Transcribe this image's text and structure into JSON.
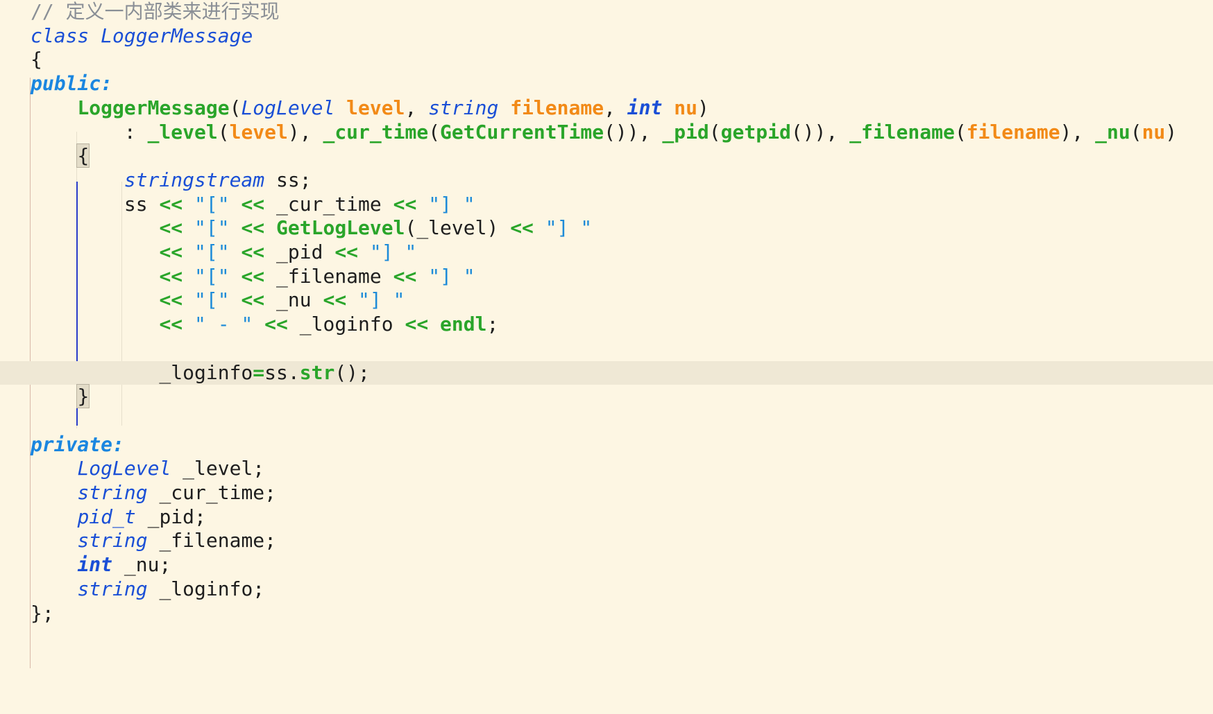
{
  "editor": {
    "theme": {
      "background": "#fdf6e3",
      "current_line": "#efe8d5",
      "comment": "#8a8f96",
      "keyword": "#1a86e0",
      "type": "#1a4fd6",
      "function": "#2aa52a",
      "parameter": "#f28a17",
      "string": "#1d8bd8"
    },
    "current_line_index": 15,
    "lines": [
      {
        "tokens": [
          {
            "c": "t-comment",
            "t": "// 定义一内部类来进行实现"
          }
        ]
      },
      {
        "tokens": [
          {
            "c": "t-storage",
            "t": "class"
          },
          {
            "c": "t-plain",
            "t": " "
          },
          {
            "c": "t-type",
            "t": "LoggerMessage"
          }
        ]
      },
      {
        "tokens": [
          {
            "c": "t-plain",
            "t": "{"
          }
        ]
      },
      {
        "tokens": [
          {
            "c": "t-kw",
            "t": "public:"
          }
        ]
      },
      {
        "tokens": [
          {
            "c": "t-plain",
            "t": "    "
          },
          {
            "c": "t-func",
            "t": "LoggerMessage"
          },
          {
            "c": "t-plain",
            "t": "("
          },
          {
            "c": "t-type",
            "t": "LogLevel"
          },
          {
            "c": "t-plain",
            "t": " "
          },
          {
            "c": "t-param",
            "t": "level"
          },
          {
            "c": "t-plain",
            "t": ", "
          },
          {
            "c": "t-type",
            "t": "string"
          },
          {
            "c": "t-plain",
            "t": " "
          },
          {
            "c": "t-param",
            "t": "filename"
          },
          {
            "c": "t-plain",
            "t": ", "
          },
          {
            "c": "t-typeb",
            "t": "int"
          },
          {
            "c": "t-plain",
            "t": " "
          },
          {
            "c": "t-param",
            "t": "nu"
          },
          {
            "c": "t-plain",
            "t": ")"
          }
        ]
      },
      {
        "tokens": [
          {
            "c": "t-plain",
            "t": "        : "
          },
          {
            "c": "t-member",
            "t": "_level"
          },
          {
            "c": "t-plain",
            "t": "("
          },
          {
            "c": "t-param",
            "t": "level"
          },
          {
            "c": "t-plain",
            "t": "), "
          },
          {
            "c": "t-member",
            "t": "_cur_time"
          },
          {
            "c": "t-plain",
            "t": "("
          },
          {
            "c": "t-func",
            "t": "GetCurrentTime"
          },
          {
            "c": "t-plain",
            "t": "()), "
          },
          {
            "c": "t-member",
            "t": "_pid"
          },
          {
            "c": "t-plain",
            "t": "("
          },
          {
            "c": "t-func",
            "t": "getpid"
          },
          {
            "c": "t-plain",
            "t": "()), "
          },
          {
            "c": "t-member",
            "t": "_filename"
          },
          {
            "c": "t-plain",
            "t": "("
          },
          {
            "c": "t-param",
            "t": "filename"
          },
          {
            "c": "t-plain",
            "t": "), "
          },
          {
            "c": "t-member",
            "t": "_nu"
          },
          {
            "c": "t-plain",
            "t": "("
          },
          {
            "c": "t-param",
            "t": "nu"
          },
          {
            "c": "t-plain",
            "t": ")"
          }
        ]
      },
      {
        "tokens": [
          {
            "c": "t-plain",
            "t": "    "
          },
          {
            "c": "brace-hl",
            "t": "{"
          }
        ]
      },
      {
        "tokens": [
          {
            "c": "t-plain",
            "t": "        "
          },
          {
            "c": "t-type",
            "t": "stringstream"
          },
          {
            "c": "t-plain",
            "t": " ss;"
          }
        ]
      },
      {
        "tokens": [
          {
            "c": "t-plain",
            "t": "        ss "
          },
          {
            "c": "t-op",
            "t": "<<"
          },
          {
            "c": "t-plain",
            "t": " "
          },
          {
            "c": "t-str",
            "t": "\"[\""
          },
          {
            "c": "t-plain",
            "t": " "
          },
          {
            "c": "t-op",
            "t": "<<"
          },
          {
            "c": "t-plain",
            "t": " _cur_time "
          },
          {
            "c": "t-op",
            "t": "<<"
          },
          {
            "c": "t-plain",
            "t": " "
          },
          {
            "c": "t-str",
            "t": "\"] \""
          }
        ]
      },
      {
        "tokens": [
          {
            "c": "t-plain",
            "t": "           "
          },
          {
            "c": "t-op",
            "t": "<<"
          },
          {
            "c": "t-plain",
            "t": " "
          },
          {
            "c": "t-str",
            "t": "\"[\""
          },
          {
            "c": "t-plain",
            "t": " "
          },
          {
            "c": "t-op",
            "t": "<<"
          },
          {
            "c": "t-plain",
            "t": " "
          },
          {
            "c": "t-func",
            "t": "GetLogLevel"
          },
          {
            "c": "t-plain",
            "t": "(_level) "
          },
          {
            "c": "t-op",
            "t": "<<"
          },
          {
            "c": "t-plain",
            "t": " "
          },
          {
            "c": "t-str",
            "t": "\"] \""
          }
        ]
      },
      {
        "tokens": [
          {
            "c": "t-plain",
            "t": "           "
          },
          {
            "c": "t-op",
            "t": "<<"
          },
          {
            "c": "t-plain",
            "t": " "
          },
          {
            "c": "t-str",
            "t": "\"[\""
          },
          {
            "c": "t-plain",
            "t": " "
          },
          {
            "c": "t-op",
            "t": "<<"
          },
          {
            "c": "t-plain",
            "t": " _pid "
          },
          {
            "c": "t-op",
            "t": "<<"
          },
          {
            "c": "t-plain",
            "t": " "
          },
          {
            "c": "t-str",
            "t": "\"] \""
          }
        ]
      },
      {
        "tokens": [
          {
            "c": "t-plain",
            "t": "           "
          },
          {
            "c": "t-op",
            "t": "<<"
          },
          {
            "c": "t-plain",
            "t": " "
          },
          {
            "c": "t-str",
            "t": "\"[\""
          },
          {
            "c": "t-plain",
            "t": " "
          },
          {
            "c": "t-op",
            "t": "<<"
          },
          {
            "c": "t-plain",
            "t": " _filename "
          },
          {
            "c": "t-op",
            "t": "<<"
          },
          {
            "c": "t-plain",
            "t": " "
          },
          {
            "c": "t-str",
            "t": "\"] \""
          }
        ]
      },
      {
        "tokens": [
          {
            "c": "t-plain",
            "t": "           "
          },
          {
            "c": "t-op",
            "t": "<<"
          },
          {
            "c": "t-plain",
            "t": " "
          },
          {
            "c": "t-str",
            "t": "\"[\""
          },
          {
            "c": "t-plain",
            "t": " "
          },
          {
            "c": "t-op",
            "t": "<<"
          },
          {
            "c": "t-plain",
            "t": " _nu "
          },
          {
            "c": "t-op",
            "t": "<<"
          },
          {
            "c": "t-plain",
            "t": " "
          },
          {
            "c": "t-str",
            "t": "\"] \""
          }
        ]
      },
      {
        "tokens": [
          {
            "c": "t-plain",
            "t": "           "
          },
          {
            "c": "t-op",
            "t": "<<"
          },
          {
            "c": "t-plain",
            "t": " "
          },
          {
            "c": "t-str",
            "t": "\" - \""
          },
          {
            "c": "t-plain",
            "t": " "
          },
          {
            "c": "t-op",
            "t": "<<"
          },
          {
            "c": "t-plain",
            "t": " _loginfo "
          },
          {
            "c": "t-op",
            "t": "<<"
          },
          {
            "c": "t-plain",
            "t": " "
          },
          {
            "c": "t-func",
            "t": "endl"
          },
          {
            "c": "t-plain",
            "t": ";"
          }
        ]
      },
      {
        "tokens": []
      },
      {
        "tokens": [
          {
            "c": "t-plain",
            "t": "           _loginfo"
          },
          {
            "c": "t-op",
            "t": "="
          },
          {
            "c": "t-plain",
            "t": "ss."
          },
          {
            "c": "t-func",
            "t": "str"
          },
          {
            "c": "t-plain",
            "t": "();"
          }
        ]
      },
      {
        "tokens": [
          {
            "c": "t-plain",
            "t": "    "
          },
          {
            "c": "brace-hl",
            "t": "}"
          }
        ]
      },
      {
        "tokens": []
      },
      {
        "tokens": [
          {
            "c": "t-kw",
            "t": "private:"
          }
        ]
      },
      {
        "tokens": [
          {
            "c": "t-plain",
            "t": "    "
          },
          {
            "c": "t-type",
            "t": "LogLevel"
          },
          {
            "c": "t-plain",
            "t": " _level;"
          }
        ]
      },
      {
        "tokens": [
          {
            "c": "t-plain",
            "t": "    "
          },
          {
            "c": "t-type",
            "t": "string"
          },
          {
            "c": "t-plain",
            "t": " _cur_time;"
          }
        ]
      },
      {
        "tokens": [
          {
            "c": "t-plain",
            "t": "    "
          },
          {
            "c": "t-type",
            "t": "pid_t"
          },
          {
            "c": "t-plain",
            "t": " _pid;"
          }
        ]
      },
      {
        "tokens": [
          {
            "c": "t-plain",
            "t": "    "
          },
          {
            "c": "t-type",
            "t": "string"
          },
          {
            "c": "t-plain",
            "t": " _filename;"
          }
        ]
      },
      {
        "tokens": [
          {
            "c": "t-plain",
            "t": "    "
          },
          {
            "c": "t-typeb",
            "t": "int"
          },
          {
            "c": "t-plain",
            "t": " _nu;"
          }
        ]
      },
      {
        "tokens": [
          {
            "c": "t-plain",
            "t": "    "
          },
          {
            "c": "t-type",
            "t": "string"
          },
          {
            "c": "t-plain",
            "t": " _loginfo;"
          }
        ]
      },
      {
        "tokens": [
          {
            "c": "t-plain",
            "t": "};"
          }
        ]
      }
    ]
  }
}
